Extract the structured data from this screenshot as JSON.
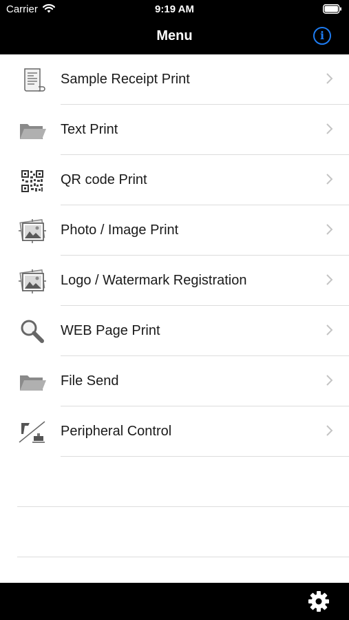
{
  "status_bar": {
    "carrier": "Carrier",
    "time": "9:19 AM"
  },
  "nav": {
    "title": "Menu",
    "info_icon": "info-icon",
    "info_glyph": "i",
    "accent_color": "#1e7cf2"
  },
  "menu": {
    "items": [
      {
        "label": "Sample Receipt Print",
        "icon": "receipt-icon"
      },
      {
        "label": "Text Print",
        "icon": "folder-icon"
      },
      {
        "label": "QR code Print",
        "icon": "qr-code-icon"
      },
      {
        "label": "Photo / Image Print",
        "icon": "photo-icon"
      },
      {
        "label": "Logo / Watermark Registration",
        "icon": "photo-icon"
      },
      {
        "label": "WEB Page Print",
        "icon": "magnifier-icon"
      },
      {
        "label": "File Send",
        "icon": "folder-icon"
      },
      {
        "label": "Peripheral Control",
        "icon": "peripheral-icon"
      }
    ]
  },
  "toolbar": {
    "settings_icon": "gear-icon"
  }
}
